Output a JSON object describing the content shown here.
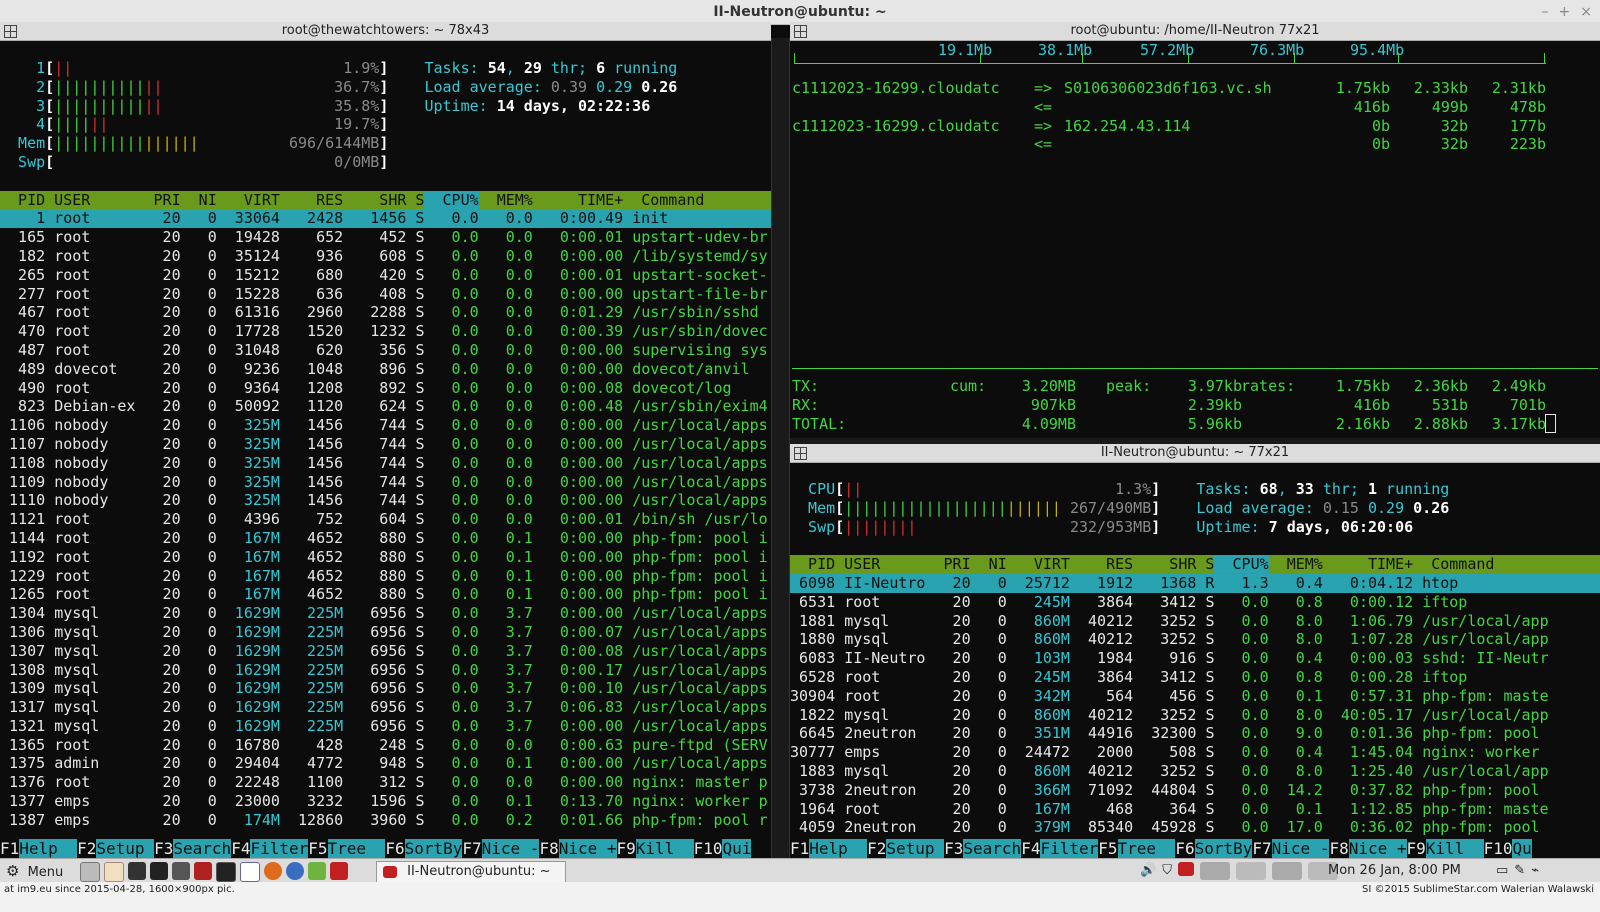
{
  "window": {
    "title": "II-Neutron@ubuntu: ~",
    "controls": [
      "–",
      "+",
      "×"
    ]
  },
  "left": {
    "pane_title": "root@thewatchtowers: ~ 78x43",
    "meters": [
      {
        "label": "1",
        "bar": "[||",
        "value": "1.9%]"
      },
      {
        "label": "2",
        "bar": "[||||||||||||",
        "value": "36.7%]"
      },
      {
        "label": "3",
        "bar": "[||||||||||||",
        "value": "35.8%]"
      },
      {
        "label": "4",
        "bar": "[||||||",
        "value": "19.7%]"
      },
      {
        "label": "Mem",
        "bar": "[||||||||||||||||",
        "value": "696/6144MB]"
      },
      {
        "label": "Swp",
        "bar": "[",
        "value": "0/0MB]"
      }
    ],
    "tasks": {
      "label": "Tasks: ",
      "count": "54",
      "sep": ", ",
      "thr": "29",
      "thr_label": " thr; ",
      "running": "6",
      "running_label": " running"
    },
    "load": {
      "label": "Load average: ",
      "v1": "0.39",
      "v2": "0.29",
      "v3": "0.26"
    },
    "uptime": {
      "label": "Uptime: ",
      "value": "14 days, 02:22:36"
    },
    "header": [
      "PID",
      "USER",
      "PRI",
      "NI",
      "VIRT",
      "RES",
      "SHR",
      "S",
      "CPU%",
      "MEM%",
      "TIME+",
      "Command"
    ],
    "rows": [
      [
        "1",
        "root",
        "20",
        "0",
        "33064",
        "2428",
        "1456",
        "S",
        "0.0",
        "0.0",
        "0:00.49",
        "init"
      ],
      [
        "165",
        "root",
        "20",
        "0",
        "19428",
        "652",
        "452",
        "S",
        "0.0",
        "0.0",
        "0:00.01",
        "upstart-udev-br"
      ],
      [
        "182",
        "root",
        "20",
        "0",
        "35124",
        "936",
        "608",
        "S",
        "0.0",
        "0.0",
        "0:00.00",
        "/lib/systemd/sy"
      ],
      [
        "265",
        "root",
        "20",
        "0",
        "15212",
        "680",
        "420",
        "S",
        "0.0",
        "0.0",
        "0:00.01",
        "upstart-socket-"
      ],
      [
        "277",
        "root",
        "20",
        "0",
        "15228",
        "636",
        "408",
        "S",
        "0.0",
        "0.0",
        "0:00.00",
        "upstart-file-br"
      ],
      [
        "467",
        "root",
        "20",
        "0",
        "61316",
        "2960",
        "2288",
        "S",
        "0.0",
        "0.0",
        "0:01.29",
        "/usr/sbin/sshd"
      ],
      [
        "470",
        "root",
        "20",
        "0",
        "17728",
        "1520",
        "1232",
        "S",
        "0.0",
        "0.0",
        "0:00.39",
        "/usr/sbin/dovec"
      ],
      [
        "487",
        "root",
        "20",
        "0",
        "31048",
        "620",
        "356",
        "S",
        "0.0",
        "0.0",
        "0:00.00",
        "supervising sys"
      ],
      [
        "489",
        "dovecot",
        "20",
        "0",
        "9236",
        "1048",
        "896",
        "S",
        "0.0",
        "0.0",
        "0:00.00",
        "dovecot/anvil"
      ],
      [
        "490",
        "root",
        "20",
        "0",
        "9364",
        "1208",
        "892",
        "S",
        "0.0",
        "0.0",
        "0:00.08",
        "dovecot/log"
      ],
      [
        "823",
        "Debian-ex",
        "20",
        "0",
        "50092",
        "1120",
        "624",
        "S",
        "0.0",
        "0.0",
        "0:00.48",
        "/usr/sbin/exim4"
      ],
      [
        "1106",
        "nobody",
        "20",
        "0",
        "325M",
        "1456",
        "744",
        "S",
        "0.0",
        "0.0",
        "0:00.00",
        "/usr/local/apps"
      ],
      [
        "1107",
        "nobody",
        "20",
        "0",
        "325M",
        "1456",
        "744",
        "S",
        "0.0",
        "0.0",
        "0:00.00",
        "/usr/local/apps"
      ],
      [
        "1108",
        "nobody",
        "20",
        "0",
        "325M",
        "1456",
        "744",
        "S",
        "0.0",
        "0.0",
        "0:00.00",
        "/usr/local/apps"
      ],
      [
        "1109",
        "nobody",
        "20",
        "0",
        "325M",
        "1456",
        "744",
        "S",
        "0.0",
        "0.0",
        "0:00.00",
        "/usr/local/apps"
      ],
      [
        "1110",
        "nobody",
        "20",
        "0",
        "325M",
        "1456",
        "744",
        "S",
        "0.0",
        "0.0",
        "0:00.00",
        "/usr/local/apps"
      ],
      [
        "1121",
        "root",
        "20",
        "0",
        "4396",
        "752",
        "604",
        "S",
        "0.0",
        "0.0",
        "0:00.01",
        "/bin/sh /usr/lo"
      ],
      [
        "1144",
        "root",
        "20",
        "0",
        "167M",
        "4652",
        "880",
        "S",
        "0.0",
        "0.1",
        "0:00.00",
        "php-fpm: pool i"
      ],
      [
        "1192",
        "root",
        "20",
        "0",
        "167M",
        "4652",
        "880",
        "S",
        "0.0",
        "0.1",
        "0:00.00",
        "php-fpm: pool i"
      ],
      [
        "1229",
        "root",
        "20",
        "0",
        "167M",
        "4652",
        "880",
        "S",
        "0.0",
        "0.1",
        "0:00.00",
        "php-fpm: pool i"
      ],
      [
        "1265",
        "root",
        "20",
        "0",
        "167M",
        "4652",
        "880",
        "S",
        "0.0",
        "0.1",
        "0:00.00",
        "php-fpm: pool i"
      ],
      [
        "1304",
        "mysql",
        "20",
        "0",
        "1629M",
        "225M",
        "6956",
        "S",
        "0.0",
        "3.7",
        "0:00.00",
        "/usr/local/apps"
      ],
      [
        "1306",
        "mysql",
        "20",
        "0",
        "1629M",
        "225M",
        "6956",
        "S",
        "0.0",
        "3.7",
        "0:00.07",
        "/usr/local/apps"
      ],
      [
        "1307",
        "mysql",
        "20",
        "0",
        "1629M",
        "225M",
        "6956",
        "S",
        "0.0",
        "3.7",
        "0:00.08",
        "/usr/local/apps"
      ],
      [
        "1308",
        "mysql",
        "20",
        "0",
        "1629M",
        "225M",
        "6956",
        "S",
        "0.0",
        "3.7",
        "0:00.17",
        "/usr/local/apps"
      ],
      [
        "1309",
        "mysql",
        "20",
        "0",
        "1629M",
        "225M",
        "6956",
        "S",
        "0.0",
        "3.7",
        "0:00.10",
        "/usr/local/apps"
      ],
      [
        "1317",
        "mysql",
        "20",
        "0",
        "1629M",
        "225M",
        "6956",
        "S",
        "0.0",
        "3.7",
        "0:06.83",
        "/usr/local/apps"
      ],
      [
        "1321",
        "mysql",
        "20",
        "0",
        "1629M",
        "225M",
        "6956",
        "S",
        "0.0",
        "3.7",
        "0:00.00",
        "/usr/local/apps"
      ],
      [
        "1365",
        "root",
        "20",
        "0",
        "16780",
        "428",
        "248",
        "S",
        "0.0",
        "0.0",
        "0:00.63",
        "pure-ftpd (SERV"
      ],
      [
        "1375",
        "admin",
        "20",
        "0",
        "29404",
        "4772",
        "948",
        "S",
        "0.0",
        "0.1",
        "0:00.00",
        "/usr/local/apps"
      ],
      [
        "1376",
        "root",
        "20",
        "0",
        "22248",
        "1100",
        "312",
        "S",
        "0.0",
        "0.0",
        "0:00.00",
        "nginx: master p"
      ],
      [
        "1377",
        "emps",
        "20",
        "0",
        "23000",
        "3232",
        "1596",
        "S",
        "0.0",
        "0.1",
        "0:13.70",
        "nginx: worker p"
      ],
      [
        "1387",
        "emps",
        "20",
        "0",
        "174M",
        "12860",
        "3960",
        "S",
        "0.0",
        "0.2",
        "0:01.66",
        "php-fpm: pool r"
      ]
    ],
    "fkeys": [
      [
        "F1",
        "Help  "
      ],
      [
        "F2",
        "Setup "
      ],
      [
        "F3",
        "Search"
      ],
      [
        "F4",
        "Filter"
      ],
      [
        "F5",
        "Tree  "
      ],
      [
        "F6",
        "SortBy"
      ],
      [
        "F7",
        "Nice -"
      ],
      [
        "F8",
        "Nice +"
      ],
      [
        "F9",
        "Kill  "
      ],
      [
        "F10",
        "Qui"
      ]
    ]
  },
  "iftop": {
    "pane_title": "root@ubuntu: /home/II-Neutron 77x21",
    "scale": [
      "19.1Mb",
      "38.1Mb",
      "57.2Mb",
      "76.3Mb",
      "95.4Mb"
    ],
    "flows": [
      {
        "host": "c1112023-16299.cloudatc",
        "dir": "=>",
        "peer": "S0106306023d6f163.vc.sh",
        "r1": "1.75kb",
        "r2": "2.33kb",
        "r3": "2.31kb"
      },
      {
        "host": "",
        "dir": "<=",
        "peer": "",
        "r1": "416b",
        "r2": "499b",
        "r3": "478b"
      },
      {
        "host": "c1112023-16299.cloudatc",
        "dir": "=>",
        "peer": "162.254.43.114",
        "r1": "0b",
        "r2": "32b",
        "r3": "177b"
      },
      {
        "host": "",
        "dir": "<=",
        "peer": "",
        "r1": "0b",
        "r2": "32b",
        "r3": "223b"
      }
    ],
    "totals": [
      {
        "label": "TX:",
        "cum_label": "cum:",
        "cum": "3.20MB",
        "peak_label": "peak:",
        "peak": "3.97kb",
        "rates_label": "rates:",
        "r1": "1.75kb",
        "r2": "2.36kb",
        "r3": "2.49kb"
      },
      {
        "label": "RX:",
        "cum_label": "",
        "cum": "907kB",
        "peak_label": "",
        "peak": "2.39kb",
        "rates_label": "",
        "r1": "416b",
        "r2": "531b",
        "r3": "701b"
      },
      {
        "label": "TOTAL:",
        "cum_label": "",
        "cum": "4.09MB",
        "peak_label": "",
        "peak": "5.96kb",
        "rates_label": "",
        "r1": "2.16kb",
        "r2": "2.88kb",
        "r3": "3.17kb"
      }
    ]
  },
  "right": {
    "pane_title": "II-Neutron@ubuntu: ~ 77x21",
    "meters": [
      {
        "label": "CPU",
        "bar": "[||",
        "value": "1.3%]"
      },
      {
        "label": "Mem",
        "bar": "[||||||||||||||||||||||||",
        "value": "267/490MB]"
      },
      {
        "label": "Swp",
        "bar": "[||||||||",
        "value": "232/953MB]"
      }
    ],
    "tasks": {
      "label": "Tasks: ",
      "count": "68",
      "sep": ", ",
      "thr": "33",
      "thr_label": " thr; ",
      "running": "1",
      "running_label": " running"
    },
    "load": {
      "label": "Load average: ",
      "v1": "0.15",
      "v2": "0.29",
      "v3": "0.26"
    },
    "uptime": {
      "label": "Uptime: ",
      "value": "7 days, 06:20:06"
    },
    "header": [
      "PID",
      "USER",
      "PRI",
      "NI",
      "VIRT",
      "RES",
      "SHR",
      "S",
      "CPU%",
      "MEM%",
      "TIME+",
      "Command"
    ],
    "rows": [
      [
        "6098",
        "II-Neutro",
        "20",
        "0",
        "25712",
        "1912",
        "1368",
        "R",
        "1.3",
        "0.4",
        "0:04.12",
        "htop"
      ],
      [
        "6531",
        "root",
        "20",
        "0",
        "245M",
        "3864",
        "3412",
        "S",
        "0.0",
        "0.8",
        "0:00.12",
        "iftop"
      ],
      [
        "1881",
        "mysql",
        "20",
        "0",
        "860M",
        "40212",
        "3252",
        "S",
        "0.0",
        "8.0",
        "1:06.79",
        "/usr/local/app"
      ],
      [
        "1880",
        "mysql",
        "20",
        "0",
        "860M",
        "40212",
        "3252",
        "S",
        "0.0",
        "8.0",
        "1:07.28",
        "/usr/local/app"
      ],
      [
        "6083",
        "II-Neutro",
        "20",
        "0",
        "103M",
        "1984",
        "916",
        "S",
        "0.0",
        "0.4",
        "0:00.03",
        "sshd: II-Neutr"
      ],
      [
        "6528",
        "root",
        "20",
        "0",
        "245M",
        "3864",
        "3412",
        "S",
        "0.0",
        "0.8",
        "0:00.28",
        "iftop"
      ],
      [
        "30904",
        "root",
        "20",
        "0",
        "342M",
        "564",
        "456",
        "S",
        "0.0",
        "0.1",
        "0:57.31",
        "php-fpm: maste"
      ],
      [
        "1822",
        "mysql",
        "20",
        "0",
        "860M",
        "40212",
        "3252",
        "S",
        "0.0",
        "8.0",
        "40:05.17",
        "/usr/local/app"
      ],
      [
        "6645",
        "2neutron",
        "20",
        "0",
        "351M",
        "44916",
        "32300",
        "S",
        "0.0",
        "9.0",
        "0:01.36",
        "php-fpm: pool"
      ],
      [
        "30777",
        "emps",
        "20",
        "0",
        "24472",
        "2000",
        "508",
        "S",
        "0.0",
        "0.4",
        "1:45.04",
        "nginx: worker"
      ],
      [
        "1883",
        "mysql",
        "20",
        "0",
        "860M",
        "40212",
        "3252",
        "S",
        "0.0",
        "8.0",
        "1:25.40",
        "/usr/local/app"
      ],
      [
        "3738",
        "2neutron",
        "20",
        "0",
        "366M",
        "71092",
        "44804",
        "S",
        "0.0",
        "14.2",
        "0:37.82",
        "php-fpm: pool"
      ],
      [
        "1964",
        "root",
        "20",
        "0",
        "167M",
        "468",
        "364",
        "S",
        "0.0",
        "0.1",
        "1:12.85",
        "php-fpm: maste"
      ],
      [
        "4059",
        "2neutron",
        "20",
        "0",
        "379M",
        "85340",
        "45928",
        "S",
        "0.0",
        "17.0",
        "0:36.02",
        "php-fpm: pool"
      ]
    ],
    "fkeys": [
      [
        "F1",
        "Help  "
      ],
      [
        "F2",
        "Setup "
      ],
      [
        "F3",
        "Search"
      ],
      [
        "F4",
        "Filter"
      ],
      [
        "F5",
        "Tree  "
      ],
      [
        "F6",
        "SortBy"
      ],
      [
        "F7",
        "Nice -"
      ],
      [
        "F8",
        "Nice +"
      ],
      [
        "F9",
        "Kill  "
      ],
      [
        "F10",
        "Qu"
      ]
    ]
  },
  "taskbar": {
    "menu_label": "Menu",
    "active_window": "II-Neutron@ubuntu: ~",
    "clock": "Mon 26 Jan,  8:00 PM"
  },
  "status": {
    "left": "at im9.eu since 2015-04-28, 1600×900px pic.",
    "right": "SI ©2015 SublimeStar.com Walerian Walawski"
  }
}
